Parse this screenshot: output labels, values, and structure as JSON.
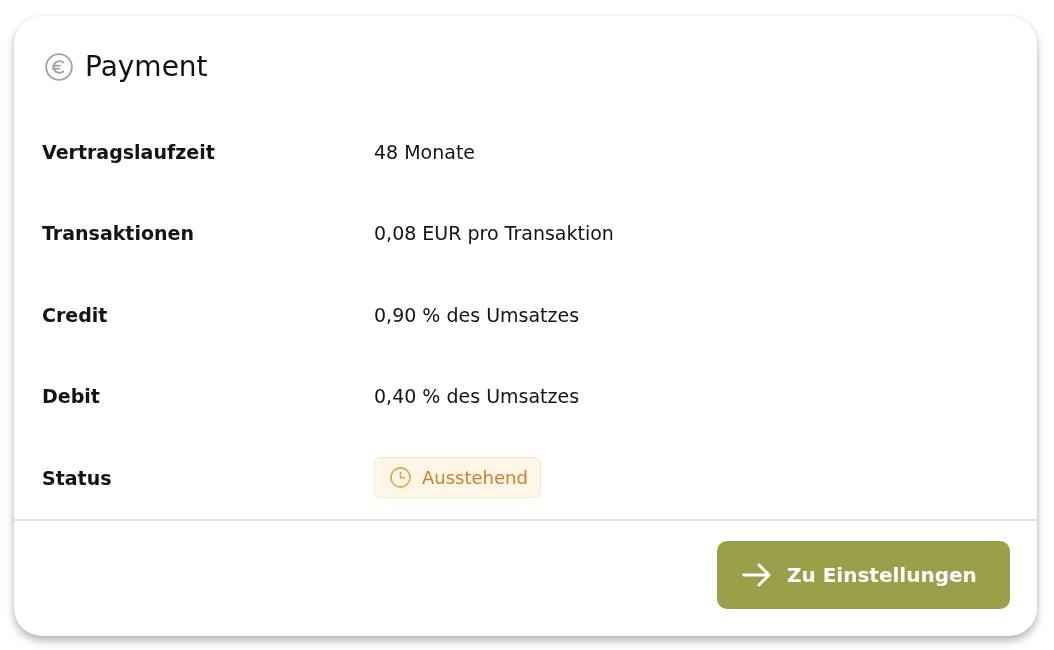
{
  "card": {
    "title": "Payment",
    "details": [
      {
        "kind": "text",
        "label": "Vertragslaufzeit",
        "value": "48 Monate"
      },
      {
        "kind": "text",
        "label": "Transaktionen",
        "value": "0,08 EUR pro Transaktion"
      },
      {
        "kind": "text",
        "label": "Credit",
        "value": "0,90 % des Umsatzes"
      },
      {
        "kind": "text",
        "label": "Debit",
        "value": "0,40 % des Umsatzes"
      },
      {
        "kind": "badge",
        "label": "Status",
        "value": "Ausstehend"
      }
    ],
    "action": {
      "label": "Zu Einstellungen"
    }
  }
}
